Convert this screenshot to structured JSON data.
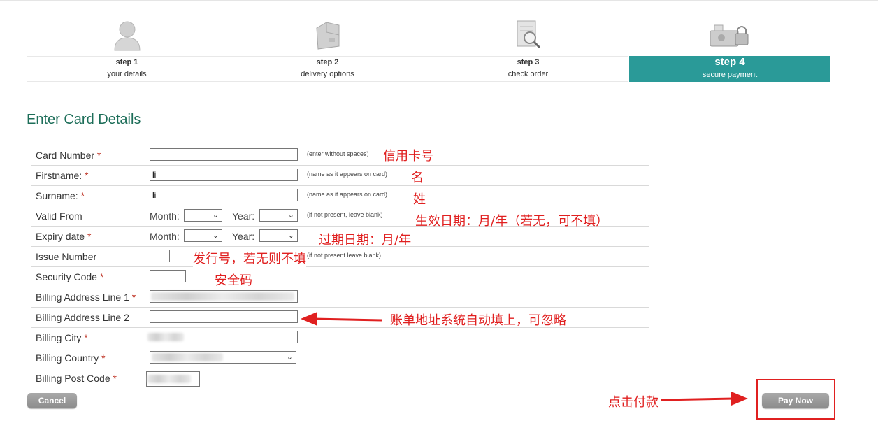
{
  "steps": [
    {
      "num": "step 1",
      "label": "your details",
      "icon": "user-icon"
    },
    {
      "num": "step 2",
      "label": "delivery options",
      "icon": "box-icon"
    },
    {
      "num": "step 3",
      "label": "check order",
      "icon": "magnifier-icon"
    },
    {
      "num": "step 4",
      "label": "secure payment",
      "icon": "lock-icon",
      "active": true
    }
  ],
  "page_title": "Enter Card Details",
  "form": {
    "card_number": {
      "label": "Card Number",
      "req": "*",
      "hint": "(enter without spaces)"
    },
    "firstname": {
      "label": "Firstname:",
      "req": "*",
      "value": "li",
      "hint": "(name as it appears on card)"
    },
    "surname": {
      "label": "Surname:",
      "req": "*",
      "value": "li",
      "hint": "(name as it appears on card)"
    },
    "valid_from": {
      "label": "Valid From",
      "month": "Month:",
      "year": "Year:",
      "hint": "(if not present, leave blank)"
    },
    "expiry": {
      "label": "Expiry date",
      "req": "*",
      "month": "Month:",
      "year": "Year:"
    },
    "issue": {
      "label": "Issue Number",
      "hint": "(if not present leave blank)"
    },
    "security": {
      "label": "Security Code",
      "req": "*"
    },
    "address1": {
      "label": "Billing Address Line 1",
      "req": "*"
    },
    "address2": {
      "label": "Billing Address Line 2"
    },
    "city": {
      "label": "Billing City",
      "req": "*"
    },
    "country": {
      "label": "Billing Country",
      "req": "*"
    },
    "postcode": {
      "label": "Billing Post Code",
      "req": "*"
    }
  },
  "annotations": {
    "card": "信用卡号",
    "first": "名",
    "sur": "姓",
    "valid": "生效日期：月/年（若无，可不填）",
    "expiry": "过期日期：月/年",
    "issue": "发行号，若无则不填",
    "security": "安全码",
    "address": "账单地址系统自动填上，可忽略",
    "pay": "点击付款"
  },
  "buttons": {
    "cancel": "Cancel",
    "pay": "Pay Now"
  },
  "colors": {
    "accent": "#2a9a98",
    "title": "#1d6e59",
    "annotation": "#e02020"
  }
}
